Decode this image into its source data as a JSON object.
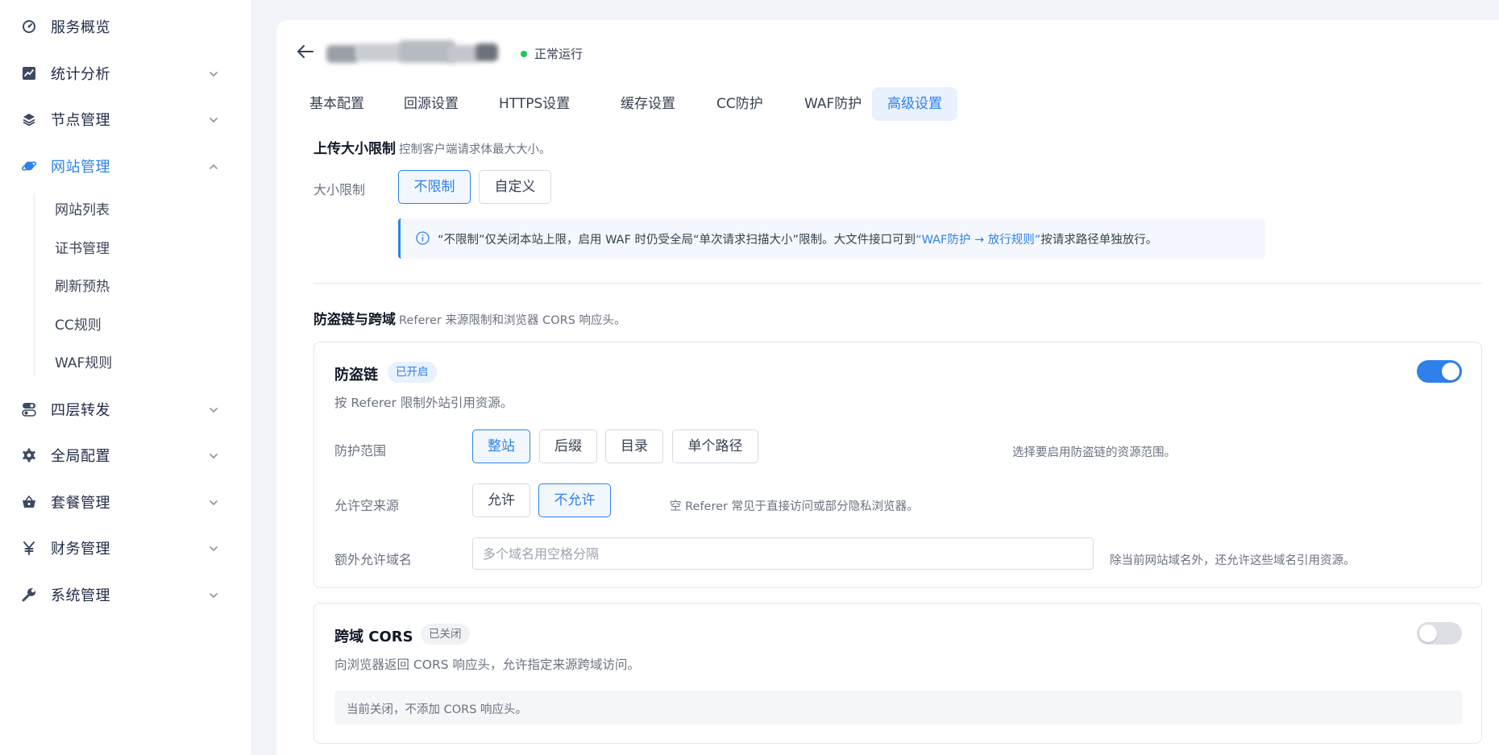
{
  "sidebar": {
    "items": [
      {
        "label": "服务概览",
        "icon": "dashboard-icon"
      },
      {
        "label": "统计分析",
        "icon": "chart-icon"
      },
      {
        "label": "节点管理",
        "icon": "layers-icon"
      },
      {
        "label": "网站管理",
        "icon": "planet-icon"
      },
      {
        "label": "四层转发",
        "icon": "toggle-icon"
      },
      {
        "label": "全局配置",
        "icon": "gear-icon"
      },
      {
        "label": "套餐管理",
        "icon": "basket-icon"
      },
      {
        "label": "财务管理",
        "icon": "yen-icon"
      },
      {
        "label": "系统管理",
        "icon": "wrench-icon"
      }
    ],
    "subitems": [
      "网站列表",
      "证书管理",
      "刷新预热",
      "CC规则",
      "WAF规则"
    ],
    "active_color": "#2f80ed"
  },
  "header": {
    "status": "正常运行",
    "status_color": "#22c55e"
  },
  "tabs": [
    {
      "label": "基本配置"
    },
    {
      "label": "回源设置"
    },
    {
      "label": "HTTPS设置"
    },
    {
      "label": "缓存设置"
    },
    {
      "label": "CC防护"
    },
    {
      "label": "WAF防护"
    },
    {
      "label": "高级设置",
      "active": true
    }
  ],
  "upload": {
    "title": "上传大小限制",
    "desc": "控制客户端请求体最大大小。",
    "label": "大小限制",
    "options": [
      "不限制",
      "自定义"
    ],
    "selected": "不限制",
    "info_prefix": "“不限制”仅关闭本站上限，启用 WAF 时仍受全局“单次请求扫描大小”限制。大文件接口可到",
    "info_link": "“WAF防护 → 放行规则”",
    "info_suffix": "按请求路径单独放行。"
  },
  "hotlink_section": {
    "title": "防盗链与跨域",
    "desc": "Referer 来源限制和浏览器 CORS 响应头。"
  },
  "hotlink": {
    "title": "防盗链",
    "badge": "已开启",
    "enabled": true,
    "desc": "按 Referer 限制外站引用资源。",
    "scope_label": "防护范围",
    "scope_options": [
      "整站",
      "后缀",
      "目录",
      "单个路径"
    ],
    "scope_selected": "整站",
    "scope_hint": "选择要启用防盗链的资源范围。",
    "empty_label": "允许空来源",
    "empty_options": [
      "允许",
      "不允许"
    ],
    "empty_selected": "不允许",
    "empty_hint": "空 Referer 常见于直接访问或部分隐私浏览器。",
    "domains_label": "额外允许域名",
    "domains_placeholder": "多个域名用空格分隔",
    "domains_value": "",
    "domains_hint": "除当前网站域名外，还允许这些域名引用资源。"
  },
  "cors": {
    "title": "跨域 CORS",
    "badge": "已关闭",
    "enabled": false,
    "desc": "向浏览器返回 CORS 响应头，允许指定来源跨域访问。",
    "note": "当前关闭，不添加 CORS 响应头。"
  }
}
